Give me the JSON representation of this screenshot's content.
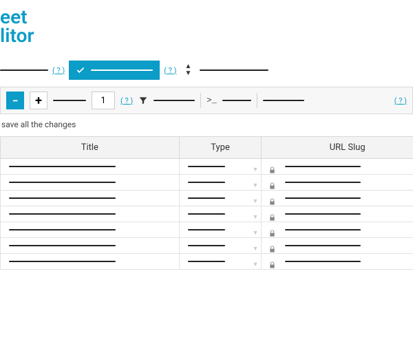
{
  "logo": {
    "line1": "eet",
    "line2": "litor"
  },
  "filter": {
    "help": "( ? )"
  },
  "toolbar": {
    "minus": "−",
    "plus": "+",
    "page": "1",
    "help": "( ? )",
    "term_prefix": ">_"
  },
  "hint": "save all the changes",
  "table": {
    "headers": {
      "title": "Title",
      "type": "Type",
      "slug": "URL Slug"
    },
    "row_count": 7
  }
}
